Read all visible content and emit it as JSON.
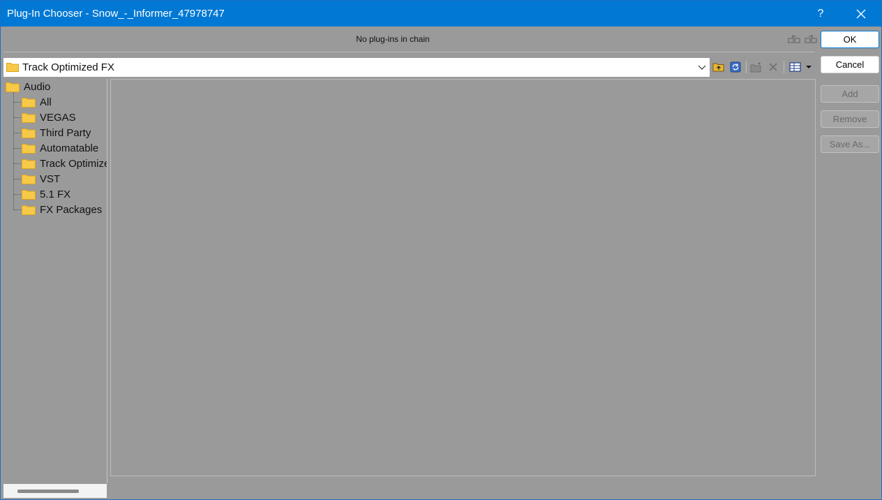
{
  "window": {
    "title": "Plug-In Chooser - Snow_-_Informer_47978747",
    "help_label": "?"
  },
  "chain": {
    "status_text": "No plug-ins in chain",
    "icons": [
      "chain-move-left-icon",
      "chain-move-right-icon"
    ]
  },
  "path": {
    "value": "Track Optimized FX"
  },
  "toolbar": {
    "icons": [
      "up-folder-icon",
      "refresh-icon",
      "new-folder-icon",
      "delete-icon",
      "view-mode-icon"
    ]
  },
  "tree": {
    "root": "Audio",
    "items": [
      "All",
      "VEGAS",
      "Third Party",
      "Automatable",
      "Track Optimized FX",
      "VST",
      "5.1 FX",
      "FX Packages"
    ]
  },
  "buttons": {
    "ok": "OK",
    "cancel": "Cancel",
    "add": "Add",
    "remove": "Remove",
    "save_as": "Save As..."
  },
  "colors": {
    "titlebar": "#0078d4",
    "folder": "#f7c948",
    "panel": "#9a9a9a"
  }
}
